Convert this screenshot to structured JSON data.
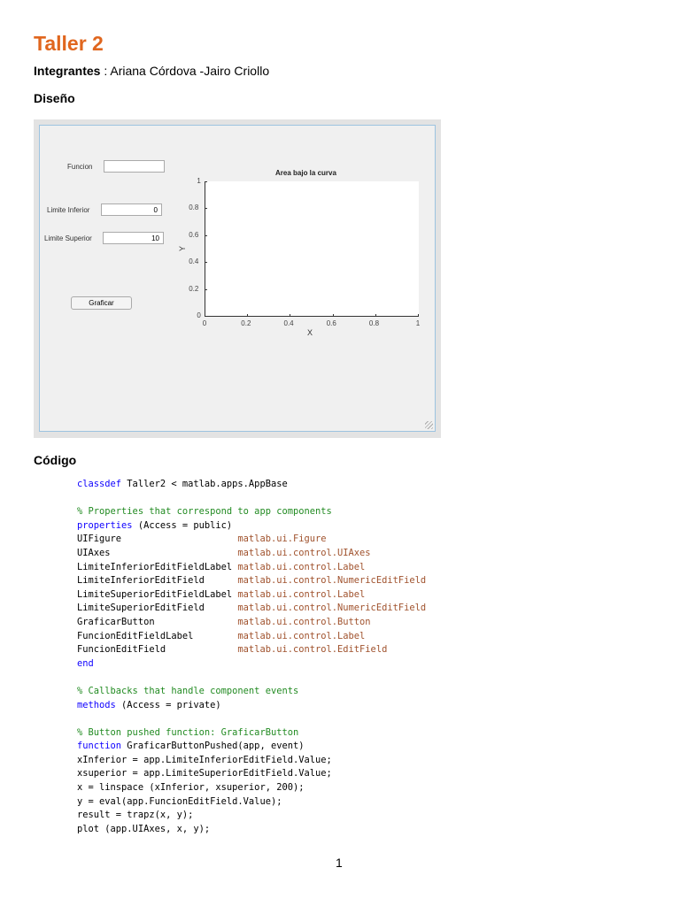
{
  "document": {
    "title": "Taller 2",
    "members_label": "Integrantes",
    "members_text": " : Ariana Córdova -Jairo Criollo",
    "section_design": "Diseño",
    "section_code": "Código",
    "page_number": "1"
  },
  "app": {
    "funcion_label": "Funcion",
    "funcion_value": "",
    "limite_inferior_label": "Limite Inferior",
    "limite_inferior_value": "0",
    "limite_superior_label": "Limite Superior",
    "limite_superior_value": "10",
    "graficar_button": "Graficar"
  },
  "chart_data": {
    "type": "line",
    "title": "Area bajo la curva",
    "xlabel": "X",
    "ylabel": "Y",
    "xlim": [
      0,
      1
    ],
    "ylim": [
      0,
      1
    ],
    "xticks": [
      "0",
      "0.2",
      "0.4",
      "0.6",
      "0.8",
      "1"
    ],
    "yticks": [
      "0",
      "0.2",
      "0.4",
      "0.6",
      "0.8",
      "1"
    ],
    "series": [],
    "grid": false
  },
  "colors": {
    "keyword": "#0e00ff",
    "comment": "#228b22",
    "string": "#a0522d",
    "title": "#e0661e"
  },
  "code": [
    [
      [
        "kw",
        "classdef"
      ],
      [
        "pl",
        " Taller2 < matlab.apps.AppBase"
      ]
    ],
    [],
    [
      [
        "cm",
        "% Properties that correspond to app components"
      ]
    ],
    [
      [
        "kw",
        "properties"
      ],
      [
        "pl",
        " (Access = public)"
      ]
    ],
    [
      [
        "pl",
        "UIFigure                     "
      ],
      [
        "st",
        "matlab.ui.Figure"
      ]
    ],
    [
      [
        "pl",
        "UIAxes                       "
      ],
      [
        "st",
        "matlab.ui.control.UIAxes"
      ]
    ],
    [
      [
        "pl",
        "LimiteInferiorEditFieldLabel "
      ],
      [
        "st",
        "matlab.ui.control.Label"
      ]
    ],
    [
      [
        "pl",
        "LimiteInferiorEditField      "
      ],
      [
        "st",
        "matlab.ui.control.NumericEditField"
      ]
    ],
    [
      [
        "pl",
        "LimiteSuperiorEditFieldLabel "
      ],
      [
        "st",
        "matlab.ui.control.Label"
      ]
    ],
    [
      [
        "pl",
        "LimiteSuperiorEditField      "
      ],
      [
        "st",
        "matlab.ui.control.NumericEditField"
      ]
    ],
    [
      [
        "pl",
        "GraficarButton               "
      ],
      [
        "st",
        "matlab.ui.control.Button"
      ]
    ],
    [
      [
        "pl",
        "FuncionEditFieldLabel        "
      ],
      [
        "st",
        "matlab.ui.control.Label"
      ]
    ],
    [
      [
        "pl",
        "FuncionEditField             "
      ],
      [
        "st",
        "matlab.ui.control.EditField"
      ]
    ],
    [
      [
        "kw",
        "end"
      ]
    ],
    [],
    [
      [
        "cm",
        "% Callbacks that handle component events"
      ]
    ],
    [
      [
        "kw",
        "methods"
      ],
      [
        "pl",
        " (Access = private)"
      ]
    ],
    [],
    [
      [
        "cm",
        "% Button pushed function: GraficarButton"
      ]
    ],
    [
      [
        "kw",
        "function"
      ],
      [
        "pl",
        " GraficarButtonPushed(app, event)"
      ]
    ],
    [
      [
        "pl",
        "xInferior = app.LimiteInferiorEditField.Value;"
      ]
    ],
    [
      [
        "pl",
        "xsuperior = app.LimiteSuperiorEditField.Value;"
      ]
    ],
    [
      [
        "pl",
        "x = linspace (xInferior, xsuperior, 200);"
      ]
    ],
    [
      [
        "pl",
        "y = eval(app.FuncionEditField.Value);"
      ]
    ],
    [
      [
        "pl",
        "result = trapz(x, y);"
      ]
    ],
    [
      [
        "pl",
        "plot (app.UIAxes, x, y);"
      ]
    ]
  ]
}
